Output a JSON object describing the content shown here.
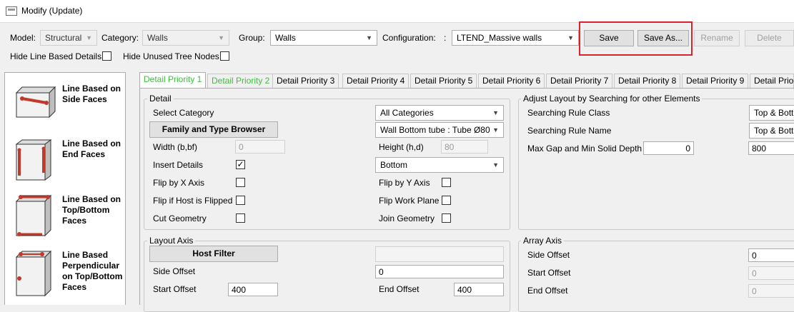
{
  "window": {
    "title": "Modify (Update)"
  },
  "toolbar": {
    "model_label": "Model:",
    "model_value": "Structural",
    "category_label": "Category:",
    "category_value": "Walls",
    "group_label": "Group:",
    "group_value": "Walls",
    "configuration_label": "Configuration:",
    "configuration_colon": ":",
    "configuration_value": "LTEND_Massive walls",
    "save_label": "Save",
    "save_as_label": "Save As...",
    "rename_label": "Rename",
    "delete_label": "Delete",
    "hide_line_based_label": "Hide Line Based Details",
    "hide_unused_label": "Hide Unused Tree Nodes"
  },
  "tree": {
    "items": [
      {
        "label": "Line Based on\nSide Faces"
      },
      {
        "label": "Line Based on\nEnd Faces"
      },
      {
        "label": "Line Based on\nTop/Bottom\nFaces"
      },
      {
        "label": "Line Based\nPerpendicular\non Top/Bottom\nFaces"
      }
    ]
  },
  "tabs": [
    {
      "label": "Detail Priority 1"
    },
    {
      "label": "Detail Priority 2"
    },
    {
      "label": "Detail Priority 3"
    },
    {
      "label": "Detail Priority 4"
    },
    {
      "label": "Detail Priority 5"
    },
    {
      "label": "Detail Priority 6"
    },
    {
      "label": "Detail Priority 7"
    },
    {
      "label": "Detail Priority 8"
    },
    {
      "label": "Detail Priority 9"
    },
    {
      "label": "Detail Prior"
    }
  ],
  "detail": {
    "title": "Detail",
    "select_category_label": "Select Category",
    "select_category_value": "All Categories",
    "family_browser_label": "Family and Type Browser",
    "family_type_value": "Wall Bottom tube : Tube Ø80",
    "width_label": "Width (b,bf)",
    "width_value": "0",
    "height_label": "Height (h,d)",
    "height_value": "80",
    "insert_details_label": "Insert Details",
    "insert_details_checked": "✓",
    "position_value": "Bottom",
    "flip_x_label": "Flip by X Axis",
    "flip_y_label": "Flip by Y Axis",
    "flip_host_label": "Flip if Host is Flipped",
    "flip_work_plane_label": "Flip Work Plane",
    "cut_geometry_label": "Cut Geometry",
    "join_geometry_label": "Join Geometry"
  },
  "adjust": {
    "title": "Adjust Layout by Searching for other Elements",
    "rule_class_label": "Searching Rule Class",
    "rule_class_value": "Top & Botto",
    "rule_name_label": "Searching Rule Name",
    "rule_name_value": "Top & Botto",
    "max_gap_label": "Max Gap and Min Solid Depth",
    "max_gap_value": "0",
    "min_depth_value": "800"
  },
  "layout_axis": {
    "title": "Layout Axis",
    "host_filter_label": "Host Filter",
    "host_filter_value": "",
    "side_offset_label": "Side Offset",
    "side_offset_value": "0",
    "start_offset_label": "Start Offset",
    "start_offset_value": "400",
    "end_offset_label": "End Offset",
    "end_offset_value": "400"
  },
  "array_axis": {
    "title": "Array Axis",
    "side_offset_label": "Side Offset",
    "side_offset_value": "0",
    "start_offset_label": "Start Offset",
    "start_offset_value": "0",
    "end_offset_label": "End Offset",
    "end_offset_value": "0"
  },
  "colors": {
    "active_tab_text": "#3cbf3c",
    "highlight_border": "#d9232e"
  }
}
